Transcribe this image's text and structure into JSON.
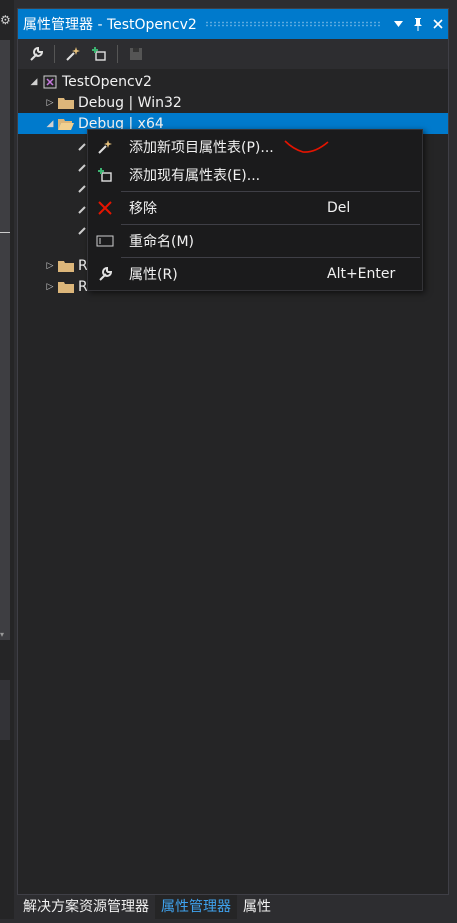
{
  "panel": {
    "title": "属性管理器 - TestOpencv2",
    "buttons": {
      "dropdown": "▼",
      "pin": "🖈",
      "close": "✕"
    }
  },
  "toolbar": {
    "items": [
      "wrench-icon",
      "add-new-sheet-icon",
      "add-existing-sheet-icon",
      "save-icon"
    ]
  },
  "tree": {
    "root": "TestOpencv2",
    "items": [
      {
        "label": "Debug | Win32"
      },
      {
        "label": "Debug | x64"
      },
      {
        "label": "R"
      },
      {
        "label": "R"
      }
    ]
  },
  "context_menu": {
    "items": [
      {
        "label": "添加新项目属性表(P)...",
        "shortcut": ""
      },
      {
        "label": "添加现有属性表(E)...",
        "shortcut": ""
      },
      {
        "label": "移除",
        "shortcut": "Del"
      },
      {
        "label": "重命名(M)",
        "shortcut": ""
      },
      {
        "label": "属性(R)",
        "shortcut": "Alt+Enter"
      }
    ]
  },
  "tabs": [
    {
      "label": "解决方案资源管理器",
      "active": false
    },
    {
      "label": "属性管理器",
      "active": true
    },
    {
      "label": "属性",
      "active": false
    }
  ],
  "colors": {
    "accent": "#007acc",
    "background": "#252526",
    "menu": "#1b1b1c",
    "active_tab_text": "#3fa2ee",
    "scribble": "#e51400"
  }
}
